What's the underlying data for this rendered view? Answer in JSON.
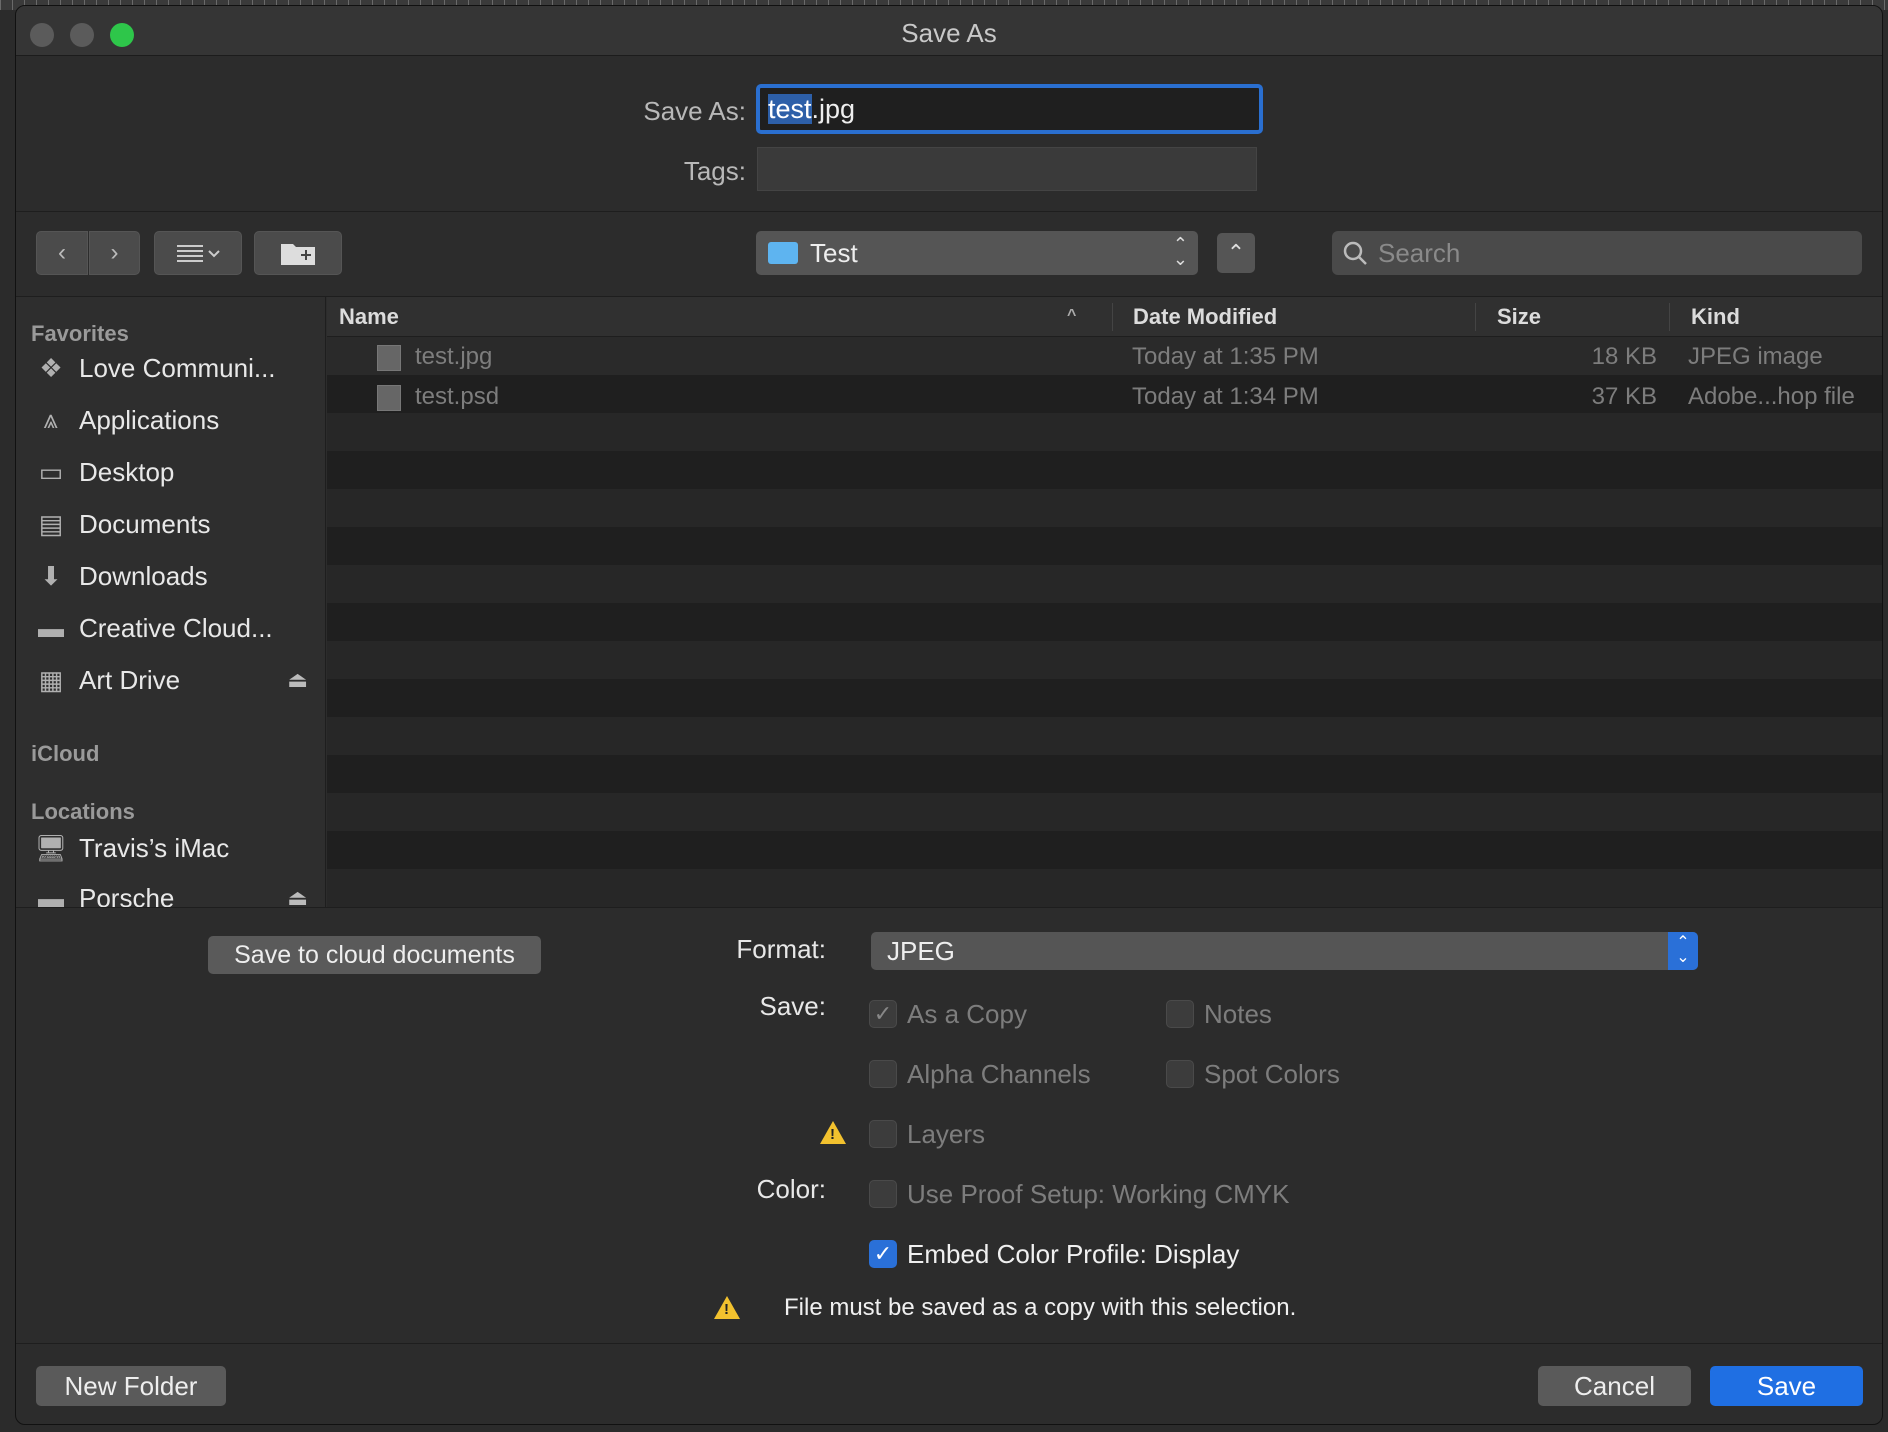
{
  "window": {
    "title": "Save As"
  },
  "form": {
    "saveas_label": "Save As:",
    "filename_selected": "test",
    "filename_ext": ".jpg",
    "tags_label": "Tags:"
  },
  "toolbar": {
    "location": "Test",
    "search_placeholder": "Search"
  },
  "sidebar": {
    "favorites_header": "Favorites",
    "favorites": [
      {
        "label": "Love Communi...",
        "icon": "dropbox-icon"
      },
      {
        "label": "Applications",
        "icon": "applications-icon"
      },
      {
        "label": "Desktop",
        "icon": "desktop-icon"
      },
      {
        "label": "Documents",
        "icon": "documents-icon"
      },
      {
        "label": "Downloads",
        "icon": "downloads-icon"
      },
      {
        "label": "Creative Cloud...",
        "icon": "folder-icon"
      },
      {
        "label": "Art Drive",
        "icon": "drive-icon"
      }
    ],
    "icloud_header": "iCloud",
    "locations_header": "Locations",
    "locations": [
      {
        "label": "Travis’s iMac",
        "icon": "imac-icon"
      },
      {
        "label": "Porsche",
        "icon": "drive-icon"
      }
    ]
  },
  "filelist": {
    "columns": [
      "Name",
      "Date Modified",
      "Size",
      "Kind"
    ],
    "rows": [
      {
        "name": "test.jpg",
        "date": "Today at 1:35 PM",
        "size": "18 KB",
        "kind": "JPEG image"
      },
      {
        "name": "test.psd",
        "date": "Today at 1:34 PM",
        "size": "37 KB",
        "kind": "Adobe...hop file"
      }
    ]
  },
  "options": {
    "cloud_button": "Save to cloud documents",
    "format_label": "Format:",
    "format_value": "JPEG",
    "save_label": "Save:",
    "as_a_copy": "As a Copy",
    "notes": "Notes",
    "alpha_channels": "Alpha Channels",
    "spot_colors": "Spot Colors",
    "layers": "Layers",
    "color_label": "Color:",
    "use_proof_setup": "Use Proof Setup:  Working CMYK",
    "embed_color_profile": "Embed Color Profile:  Display",
    "warning_message": "File must be saved as a copy with this selection."
  },
  "footer": {
    "new_folder": "New Folder",
    "cancel": "Cancel",
    "save": "Save"
  },
  "colors": {
    "accent": "#2a70d8",
    "traffic_green": "#2ec64a",
    "warning": "#f2c12e"
  }
}
